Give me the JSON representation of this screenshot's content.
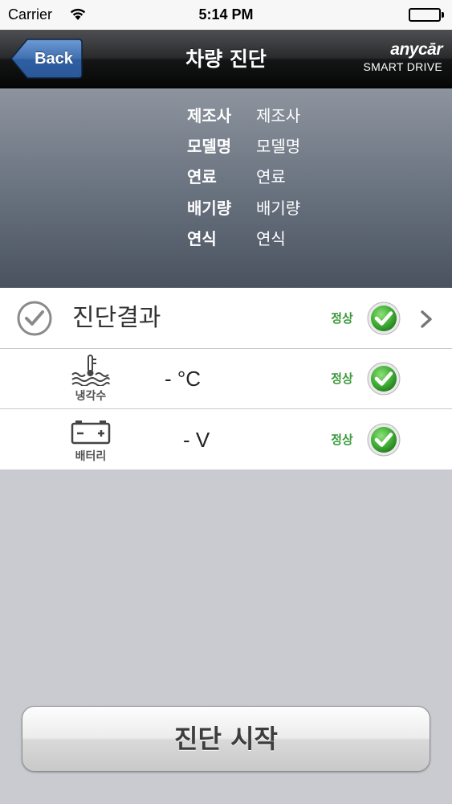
{
  "status_bar": {
    "carrier": "Carrier",
    "time": "5:14 PM",
    "wifi_icon": "wifi-icon",
    "battery_icon": "battery-full-icon"
  },
  "nav": {
    "back_label": "Back",
    "title": "차량 진단",
    "brand_logo": "anycār",
    "brand_tagline": "SMART DRIVE"
  },
  "vehicle_info": {
    "manufacturer": {
      "label": "제조사",
      "value": "제조사"
    },
    "model": {
      "label": "모델명",
      "value": "모델명"
    },
    "fuel": {
      "label": "연료",
      "value": "연료"
    },
    "displacement": {
      "label": "배기량",
      "value": "배기량"
    },
    "year": {
      "label": "연식",
      "value": "연식"
    }
  },
  "diagnosis": {
    "result": {
      "title": "진단결과",
      "status": "정상",
      "icon": "check-circle-icon"
    },
    "coolant": {
      "label": "냉각수",
      "value": "- °C",
      "status": "정상",
      "icon": "coolant-temperature-icon"
    },
    "battery": {
      "label": "배터리",
      "value": "- V",
      "status": "정상",
      "icon": "battery-icon"
    }
  },
  "actions": {
    "start_label": "진단 시작"
  },
  "colors": {
    "ok_green": "#3a9a3a",
    "back_button_blue": "#3f6fb0",
    "panel_top": "#8d949e",
    "panel_bottom": "#4a5260"
  }
}
